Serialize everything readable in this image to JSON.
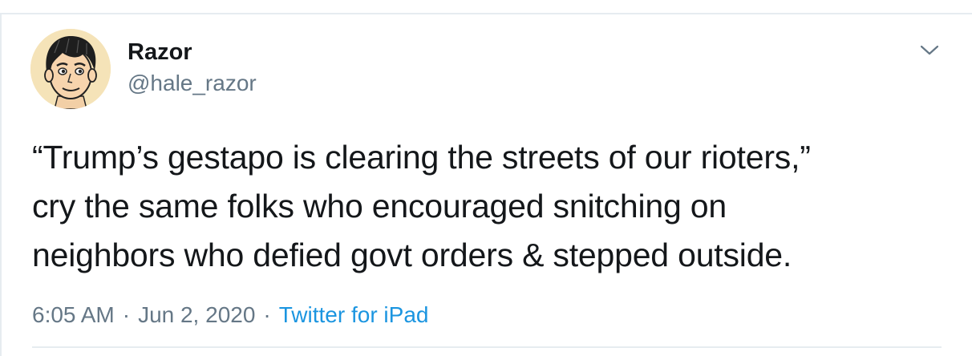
{
  "author": {
    "display_name": "Razor",
    "handle": "@hale_razor",
    "avatar_icon": "cartoon-portrait-avatar"
  },
  "tweet": {
    "lines": [
      "“Trump’s gestapo is clearing the streets of our rioters,”",
      "cry the same folks who encouraged snitching on",
      "neighbors who defied govt orders & stepped outside."
    ]
  },
  "meta": {
    "time": "6:05 AM",
    "separator": "·",
    "date": "Jun 2, 2020",
    "source": "Twitter for iPad"
  },
  "menu": {
    "icon": "chevron-down-icon"
  },
  "colors": {
    "text": "#14171a",
    "muted": "#657786",
    "link": "#1b95e0",
    "border": "#e6ecf0"
  }
}
